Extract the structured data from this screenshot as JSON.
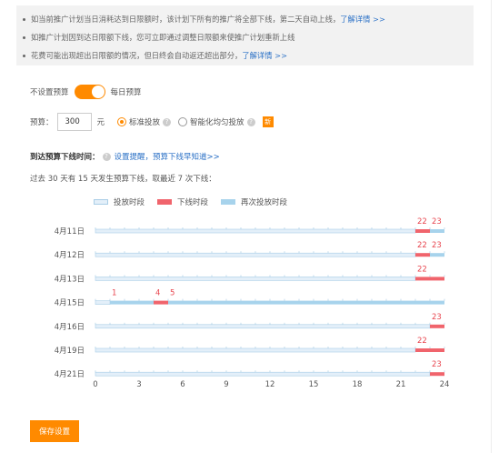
{
  "notices": [
    {
      "text": "如当前推广计划当日消耗达到日限额时，该计划下所有的推广将全部下线，第二天自动上线，",
      "link": "了解详情 >>"
    },
    {
      "text": "如推广计划因到达日限额下线，您可立即通过调整日限额来使推广计划重新上线",
      "link": ""
    },
    {
      "text": "花费可能出现超出日限额的情况，但日终会自动返还超出部分，",
      "link": "了解详情 >>"
    }
  ],
  "budget_mode": {
    "off_label": "不设置预算",
    "on_label": "每日预算",
    "enabled": true
  },
  "budget": {
    "label": "预算：",
    "value": "300",
    "unit": "元"
  },
  "delivery": {
    "standard_label": "标准投放",
    "smart_label": "智能化均匀投放",
    "selected": "standard",
    "new_badge": "新"
  },
  "offline_section": {
    "title": "到达预算下线时间：",
    "reminder_link": "设置提醒，预算下线早知道>>",
    "summary": "过去 30 天有 15 天发生预算下线，取最近 7 次下线："
  },
  "legend": {
    "items": [
      {
        "label": "投放时段",
        "color": "#e3eff9",
        "border": "#a9cde6"
      },
      {
        "label": "下线时段",
        "color": "#f0646c",
        "border": "#f0646c"
      },
      {
        "label": "再次投放时段",
        "color": "#a7d3ec",
        "border": "#a7d3ec"
      }
    ]
  },
  "chart_data": {
    "type": "timeline",
    "x_ticks": [
      0,
      3,
      6,
      9,
      12,
      15,
      18,
      21,
      24
    ],
    "xlim": [
      0,
      24
    ],
    "colors": {
      "active": "#e3eff9",
      "active_border": "#a9cde6",
      "offline": "#f0646c",
      "resumed": "#a7d3ec",
      "label": "#e8464f"
    },
    "rows": [
      {
        "date": "4月11日",
        "segments": [
          {
            "type": "active",
            "start": 0,
            "end": 22
          },
          {
            "type": "offline",
            "start": 22,
            "end": 23
          },
          {
            "type": "resumed",
            "start": 23,
            "end": 24
          }
        ],
        "labels": [
          "22",
          "23"
        ]
      },
      {
        "date": "4月12日",
        "segments": [
          {
            "type": "active",
            "start": 0,
            "end": 22
          },
          {
            "type": "offline",
            "start": 22,
            "end": 23
          },
          {
            "type": "resumed",
            "start": 23,
            "end": 24
          }
        ],
        "labels": [
          "22",
          "23"
        ]
      },
      {
        "date": "4月13日",
        "segments": [
          {
            "type": "active",
            "start": 0,
            "end": 22
          },
          {
            "type": "offline",
            "start": 22,
            "end": 24
          }
        ],
        "labels": [
          "22"
        ]
      },
      {
        "date": "4月15日",
        "segments": [
          {
            "type": "active",
            "start": 0,
            "end": 1
          },
          {
            "type": "resumed",
            "start": 1,
            "end": 4
          },
          {
            "type": "offline",
            "start": 4,
            "end": 5
          },
          {
            "type": "resumed",
            "start": 5,
            "end": 24
          }
        ],
        "labels": [
          "1",
          "4",
          "5"
        ]
      },
      {
        "date": "4月16日",
        "segments": [
          {
            "type": "active",
            "start": 0,
            "end": 23
          },
          {
            "type": "offline",
            "start": 23,
            "end": 24
          }
        ],
        "labels": [
          "23"
        ]
      },
      {
        "date": "4月19日",
        "segments": [
          {
            "type": "active",
            "start": 0,
            "end": 22
          },
          {
            "type": "offline",
            "start": 22,
            "end": 24
          }
        ],
        "labels": [
          "22"
        ]
      },
      {
        "date": "4月21日",
        "segments": [
          {
            "type": "active",
            "start": 0,
            "end": 23
          },
          {
            "type": "offline",
            "start": 23,
            "end": 24
          }
        ],
        "labels": [
          "23"
        ]
      }
    ]
  },
  "save_button": "保存设置"
}
